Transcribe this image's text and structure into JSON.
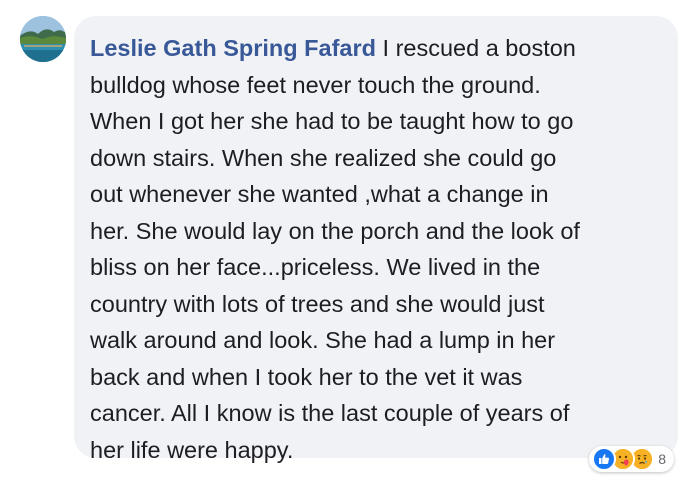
{
  "comment": {
    "author": "Leslie Gath Spring Fafard",
    "text": "I rescued a boston\nbulldog whose feet never touch the ground.\nWhen I got her she had to be taught how to go\ndown stairs. When she realized she could go\nout whenever she wanted ,what a change in\nher. She would lay on the porch and the look of\nbliss on her face...priceless. We lived in the\ncountry with lots of trees and she would just\nwalk around and look. She had a lump in her\nback and when I took her to the vet it was\ncancer. All I know is the last couple of years of\nher life were happy.",
    "avatar_icon": "profile-photo-landscape"
  },
  "reactions": {
    "icons": [
      "like-icon",
      "love-icon",
      "sad-icon"
    ],
    "count": "8"
  },
  "colors": {
    "author_link": "#385898",
    "bubble_bg": "#f0f2f5",
    "text": "#1c1e21",
    "like": "#1877f2",
    "love": "#f33e58",
    "sad": "#f7b125",
    "muted": "#65676b"
  }
}
